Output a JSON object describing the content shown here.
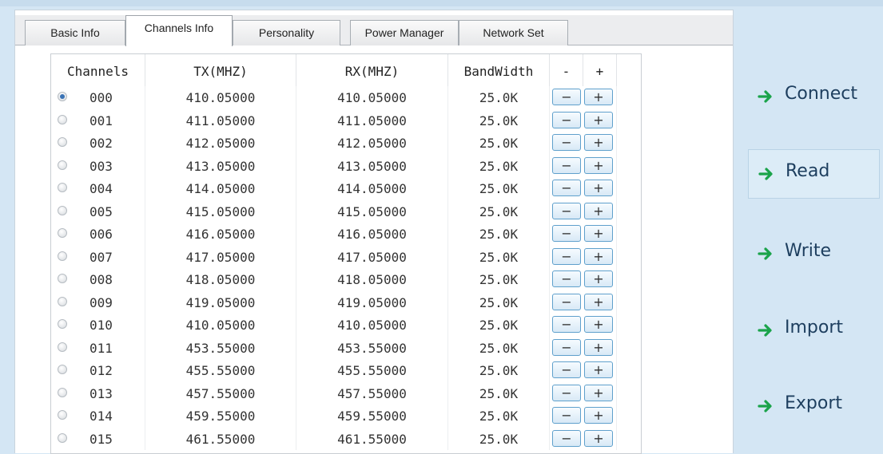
{
  "tabs": [
    {
      "label": "Basic Info"
    },
    {
      "label": "Channels Info"
    },
    {
      "label": "Personality"
    },
    {
      "label": "Power Manager"
    },
    {
      "label": "Network Set"
    }
  ],
  "grid": {
    "headers": {
      "channels": "Channels",
      "tx": "TX(MHZ)",
      "rx": "RX(MHZ)",
      "bandwidth": "BandWidth",
      "minus": "-",
      "plus": "+"
    },
    "button_minus": "−",
    "button_plus": "+",
    "rows": [
      {
        "channel": "000",
        "tx": "410.05000",
        "rx": "410.05000",
        "bw": "25.0K",
        "selected": true
      },
      {
        "channel": "001",
        "tx": "411.05000",
        "rx": "411.05000",
        "bw": "25.0K",
        "selected": false
      },
      {
        "channel": "002",
        "tx": "412.05000",
        "rx": "412.05000",
        "bw": "25.0K",
        "selected": false
      },
      {
        "channel": "003",
        "tx": "413.05000",
        "rx": "413.05000",
        "bw": "25.0K",
        "selected": false
      },
      {
        "channel": "004",
        "tx": "414.05000",
        "rx": "414.05000",
        "bw": "25.0K",
        "selected": false
      },
      {
        "channel": "005",
        "tx": "415.05000",
        "rx": "415.05000",
        "bw": "25.0K",
        "selected": false
      },
      {
        "channel": "006",
        "tx": "416.05000",
        "rx": "416.05000",
        "bw": "25.0K",
        "selected": false
      },
      {
        "channel": "007",
        "tx": "417.05000",
        "rx": "417.05000",
        "bw": "25.0K",
        "selected": false
      },
      {
        "channel": "008",
        "tx": "418.05000",
        "rx": "418.05000",
        "bw": "25.0K",
        "selected": false
      },
      {
        "channel": "009",
        "tx": "419.05000",
        "rx": "419.05000",
        "bw": "25.0K",
        "selected": false
      },
      {
        "channel": "010",
        "tx": "410.05000",
        "rx": "410.05000",
        "bw": "25.0K",
        "selected": false
      },
      {
        "channel": "011",
        "tx": "453.55000",
        "rx": "453.55000",
        "bw": "25.0K",
        "selected": false
      },
      {
        "channel": "012",
        "tx": "455.55000",
        "rx": "455.55000",
        "bw": "25.0K",
        "selected": false
      },
      {
        "channel": "013",
        "tx": "457.55000",
        "rx": "457.55000",
        "bw": "25.0K",
        "selected": false
      },
      {
        "channel": "014",
        "tx": "459.55000",
        "rx": "459.55000",
        "bw": "25.0K",
        "selected": false
      },
      {
        "channel": "015",
        "tx": "461.55000",
        "rx": "461.55000",
        "bw": "25.0K",
        "selected": false
      }
    ]
  },
  "side_buttons": [
    {
      "label": "Connect",
      "name": "connect-button",
      "icon": "arrow-right-icon",
      "highlighted": false
    },
    {
      "label": "Read",
      "name": "read-button",
      "icon": "arrow-right-icon",
      "highlighted": true
    },
    {
      "label": "Write",
      "name": "write-button",
      "icon": "arrow-right-icon",
      "highlighted": false
    },
    {
      "label": "Import",
      "name": "import-button",
      "icon": "arrow-right-icon",
      "highlighted": false
    },
    {
      "label": "Export",
      "name": "export-button",
      "icon": "arrow-right-icon",
      "highlighted": false
    }
  ],
  "colors": {
    "background": "#d4e6f4",
    "arrow": "#1aa34a",
    "button_border": "#5fa0cc",
    "radio_checked": "#3a73b5"
  }
}
